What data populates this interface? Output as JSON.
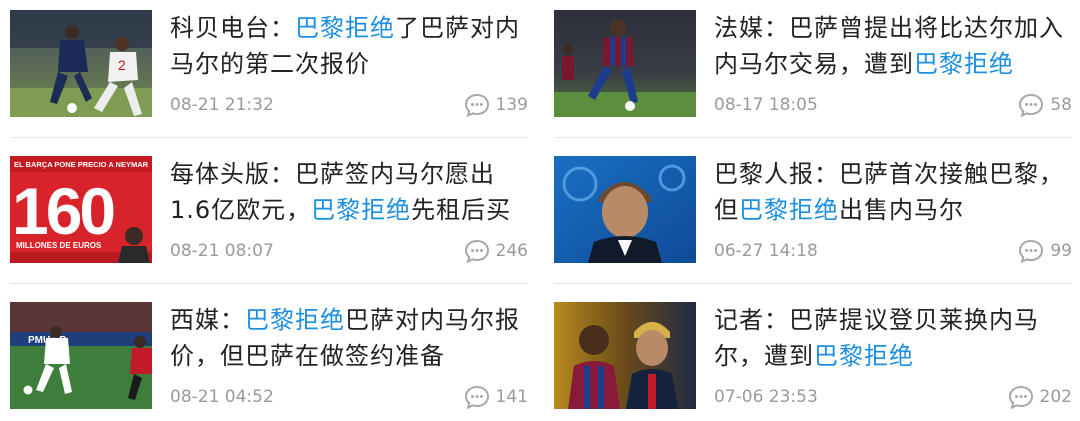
{
  "feed": {
    "items": [
      {
        "title_pre": "科贝电台：",
        "title_hl": "巴黎拒绝",
        "title_post": "了巴萨对内马尔的第二次报价",
        "date": "08-21 21:32",
        "comments": "139",
        "image": "football-match-photo"
      },
      {
        "title_pre": "法媒：巴萨曾提出将比达尔加入内马尔交易，遭到",
        "title_hl": "巴黎拒绝",
        "title_post": "",
        "date": "08-17 18:05",
        "comments": "58",
        "image": "barcelona-player-photo"
      },
      {
        "title_pre": "每体头版：巴萨签内马尔愿出1.6亿欧元，",
        "title_hl": "巴黎拒绝",
        "title_post": "先租后买",
        "date": "08-21 08:07",
        "comments": "246",
        "image": "newspaper-front-page",
        "image_headline": "EL BARÇA PONE PRECIO A NEYMAR",
        "image_number": "160",
        "image_subline": "MILLONES DE EUROS"
      },
      {
        "title_pre": "巴黎人报：巴萨首次接触巴黎，但",
        "title_hl": "巴黎拒绝",
        "title_post": "出售内马尔",
        "date": "06-27 14:18",
        "comments": "99",
        "image": "neymar-press-conference-photo"
      },
      {
        "title_pre": "西媒：",
        "title_hl": "巴黎拒绝",
        "title_post": "巴萨对内马尔报价，但巴萨在做签约准备",
        "date": "08-21 04:52",
        "comments": "141",
        "image": "stadium-match-photo",
        "image_banner": "PMU.FR"
      },
      {
        "title_pre": "记者：巴萨提议登贝莱换内马尔，遭到",
        "title_hl": "巴黎拒绝",
        "title_post": "",
        "date": "07-06 23:53",
        "comments": "202",
        "image": "two-players-photo"
      }
    ]
  },
  "colors": {
    "highlight": "#1c8fe0",
    "title": "#222222",
    "meta": "#9a9a9a",
    "divider": "#e6e6e6"
  }
}
